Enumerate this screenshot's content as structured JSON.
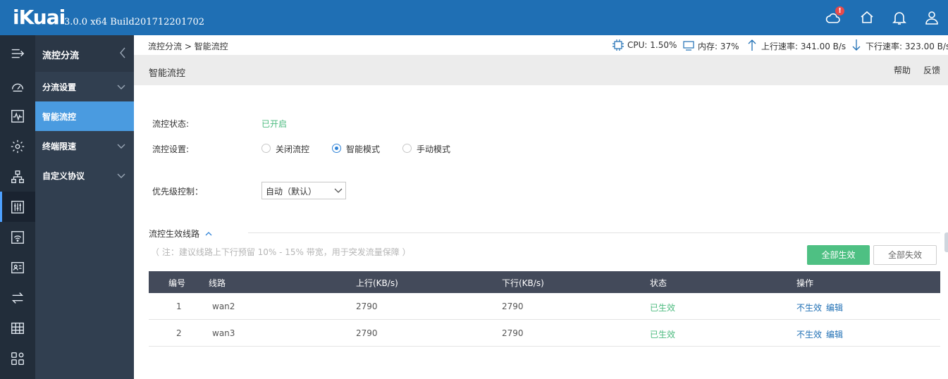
{
  "header": {
    "brand": "iKuai",
    "version": "3.0.0 x64 Build201712201702",
    "alert_badge": "!",
    "icons": [
      "cloud-alert-icon",
      "home-icon",
      "bell-icon",
      "user-icon"
    ]
  },
  "rail": {
    "icons": [
      "menu-toggle-icon",
      "dashboard-icon",
      "monitor-icon",
      "settings-icon",
      "network-icon",
      "flow-control-icon",
      "wifi-icon",
      "user-auth-icon",
      "transfer-icon",
      "grid-icon",
      "apps-icon"
    ],
    "active_index": 5
  },
  "subnav": {
    "title": "流控分流",
    "items": [
      {
        "label": "分流设置",
        "has_chevron": true
      },
      {
        "label": "智能流控",
        "has_chevron": false
      },
      {
        "label": "终端限速",
        "has_chevron": true
      },
      {
        "label": "自定义协议",
        "has_chevron": true
      }
    ],
    "active_index": 1
  },
  "breadcrumb": "流控分流 > 智能流控",
  "stats": {
    "cpu": "CPU: 1.50%",
    "memory": "内存: 37%",
    "upload": "上行速率: 341.00 B/s",
    "download": "下行速率: 323.00 B/s"
  },
  "page": {
    "title": "智能流控",
    "help": "帮助",
    "feedback": "反馈"
  },
  "form": {
    "status_label": "流控状态:",
    "status_value": "已开启",
    "setting_label": "流控设置:",
    "modes": [
      "关闭流控",
      "智能模式",
      "手动模式"
    ],
    "selected_mode": "智能模式",
    "priority_label": "优先级控制：",
    "priority_value": "自动（默认）"
  },
  "lines_section": {
    "title": "流控生效线路",
    "note": "（ 注：建议线路上下行预留 10% - 15% 带宽，用于突发流量保障 ）",
    "enable_all": "全部生效",
    "disable_all": "全部失效",
    "columns": [
      "编号",
      "线路",
      "上行(KB/s)",
      "下行(KB/s)",
      "状态",
      "操作"
    ],
    "rows": [
      {
        "id": "1",
        "line": "wan2",
        "up": "2790",
        "down": "2790",
        "status": "已生效",
        "action1": "不生效",
        "action2": "编辑"
      },
      {
        "id": "2",
        "line": "wan3",
        "up": "2790",
        "down": "2790",
        "status": "已生效",
        "action1": "不生效",
        "action2": "编辑"
      }
    ]
  },
  "colors": {
    "header_blue": "#1f6fb4",
    "rail_bg": "#222d3a",
    "subnav_bg": "#313f50",
    "active_blue": "#4a9be0",
    "success_green": "#4cbb7f"
  }
}
